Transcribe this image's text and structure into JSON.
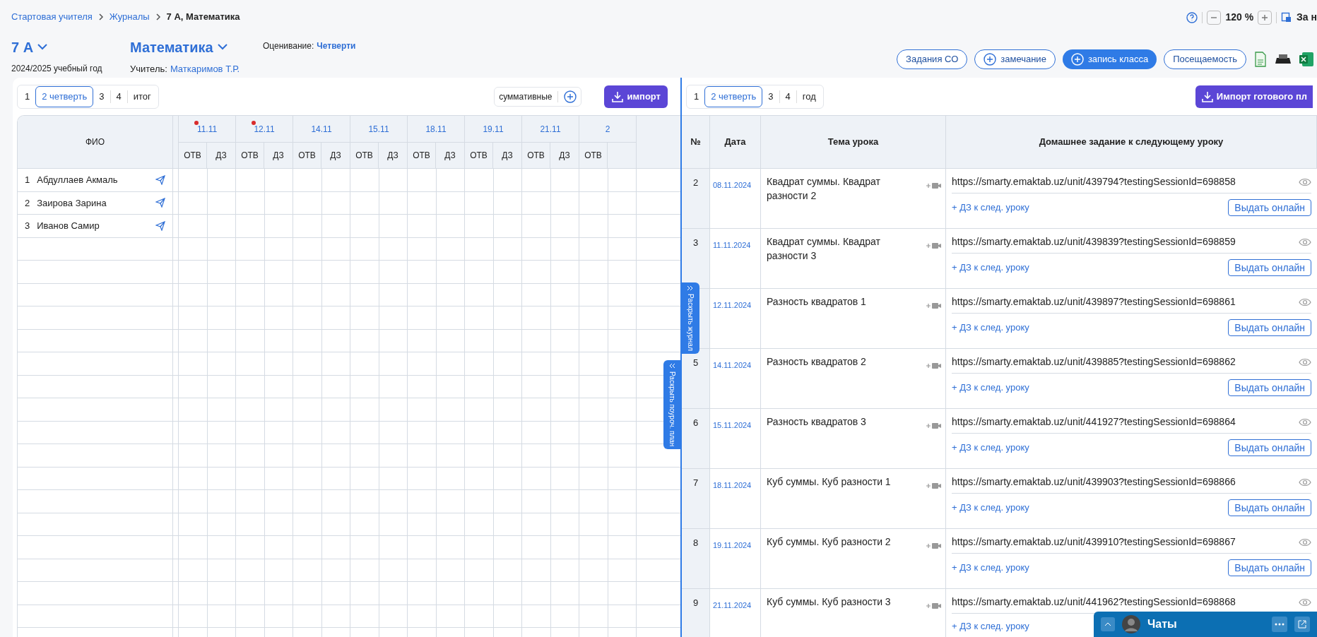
{
  "breadcrumb": [
    "Стартовая учителя",
    "Журналы",
    "7 А, Математика"
  ],
  "zoom": {
    "value": "120 %",
    "side_label": "За н"
  },
  "class_selector": {
    "label": "7 А",
    "year": "2024/2025 учебный год"
  },
  "subject_selector": {
    "label": "Математика",
    "teacher_label": "Учитель:",
    "teacher": "Маткаримов Т.Р."
  },
  "grading": {
    "label": "Оценивание:",
    "value": "Четверти"
  },
  "actions": [
    {
      "label": "Задания СО",
      "kind": "outline"
    },
    {
      "label": "замечание",
      "kind": "outline-plus"
    },
    {
      "label": "запись класса",
      "kind": "filled-plus"
    },
    {
      "label": "Посещаемость",
      "kind": "outline"
    }
  ],
  "journal": {
    "tabs": [
      {
        "label": "1",
        "selected": false
      },
      {
        "label": "2 четверть",
        "selected": true
      },
      {
        "label": "3",
        "selected": false
      },
      {
        "label": "4",
        "selected": false
      },
      {
        "label": "итог",
        "selected": false
      }
    ],
    "summative": "суммативные",
    "import_button": "импорт",
    "name_header": "ФИО",
    "dates": [
      {
        "date": "11.11",
        "marked": true,
        "sub_columns": [
          "ОТВ",
          "ДЗ"
        ]
      },
      {
        "date": "12.11",
        "marked": true,
        "sub_columns": [
          "ОТВ",
          "ДЗ"
        ]
      },
      {
        "date": "14.11",
        "marked": false,
        "sub_columns": [
          "ОТВ",
          "ДЗ"
        ]
      },
      {
        "date": "15.11",
        "marked": false,
        "sub_columns": [
          "ОТВ",
          "ДЗ"
        ]
      },
      {
        "date": "18.11",
        "marked": false,
        "sub_columns": [
          "ОТВ",
          "ДЗ"
        ]
      },
      {
        "date": "19.11",
        "marked": false,
        "sub_columns": [
          "ОТВ",
          "ДЗ"
        ]
      },
      {
        "date": "21.11",
        "marked": false,
        "sub_columns": [
          "ОТВ",
          "ДЗ"
        ]
      },
      {
        "date": "2",
        "marked": false,
        "sub_columns": [
          "ОТВ"
        ]
      }
    ],
    "students": [
      {
        "number": "1",
        "name": "Абдуллаев Акмаль"
      },
      {
        "number": "2",
        "name": "Заирова Зарина"
      },
      {
        "number": "3",
        "name": "Иванов Самир"
      }
    ]
  },
  "plan": {
    "tabs": [
      {
        "label": "1",
        "selected": false
      },
      {
        "label": "2 четверть",
        "selected": true
      },
      {
        "label": "3",
        "selected": false
      },
      {
        "label": "4",
        "selected": false
      },
      {
        "label": "год",
        "selected": false
      }
    ],
    "import_button": "Импорт готового пл",
    "columns": [
      "№",
      "Дата",
      "Тема урока",
      "Домашнее задание к следующему уроку"
    ],
    "rows": [
      {
        "number": "2",
        "date": "08.11.2024",
        "topic": "Квадрат суммы. Квадрат разности 2",
        "homework": "https://smarty.emaktab.uz/unit/439794?testingSessionId=698858",
        "add_homework": "+ ДЗ к след. уроку",
        "online_button": "Выдать онлайн"
      },
      {
        "number": "3",
        "date": "11.11.2024",
        "topic": "Квадрат суммы. Квадрат разности 3",
        "homework": "https://smarty.emaktab.uz/unit/439839?testingSessionId=698859",
        "add_homework": "+ ДЗ к след. уроку",
        "online_button": "Выдать онлайн"
      },
      {
        "date": "12.11.2024",
        "topic": "Разность квадратов 1",
        "homework": "https://smarty.emaktab.uz/unit/439897?testingSessionId=698861",
        "add_homework": "+ ДЗ к след. уроку",
        "online_button": "Выдать онлайн"
      },
      {
        "number": "5",
        "date": "14.11.2024",
        "topic": "Разность квадратов 2",
        "homework": "https://smarty.emaktab.uz/unit/439885?testingSessionId=698862",
        "add_homework": "+ ДЗ к след. уроку",
        "online_button": "Выдать онлайн"
      },
      {
        "number": "6",
        "date": "15.11.2024",
        "topic": "Разность квадратов 3",
        "homework": "https://smarty.emaktab.uz/unit/441927?testingSessionId=698864",
        "add_homework": "+ ДЗ к след. уроку",
        "online_button": "Выдать онлайн"
      },
      {
        "number": "7",
        "date": "18.11.2024",
        "topic": "Куб суммы. Куб разности 1",
        "homework": "https://smarty.emaktab.uz/unit/439903?testingSessionId=698866",
        "add_homework": "+ ДЗ к след. уроку",
        "online_button": "Выдать онлайн"
      },
      {
        "number": "8",
        "date": "19.11.2024",
        "topic": "Куб суммы. Куб разности 2",
        "homework": "https://smarty.emaktab.uz/unit/439910?testingSessionId=698867",
        "add_homework": "+ ДЗ к след. уроку",
        "online_button": "Выдать онлайн"
      },
      {
        "number": "9",
        "date": "21.11.2024",
        "topic": "Куб суммы. Куб разности 3",
        "homework": "https://smarty.emaktab.uz/unit/441962?testingSessionId=698868",
        "add_homework": "+ ДЗ к след. уроку"
      }
    ]
  },
  "side_tabs": [
    "Раскрыть журнал",
    "Раскрыть поуроч. план"
  ],
  "chat": {
    "title": "Чаты"
  }
}
